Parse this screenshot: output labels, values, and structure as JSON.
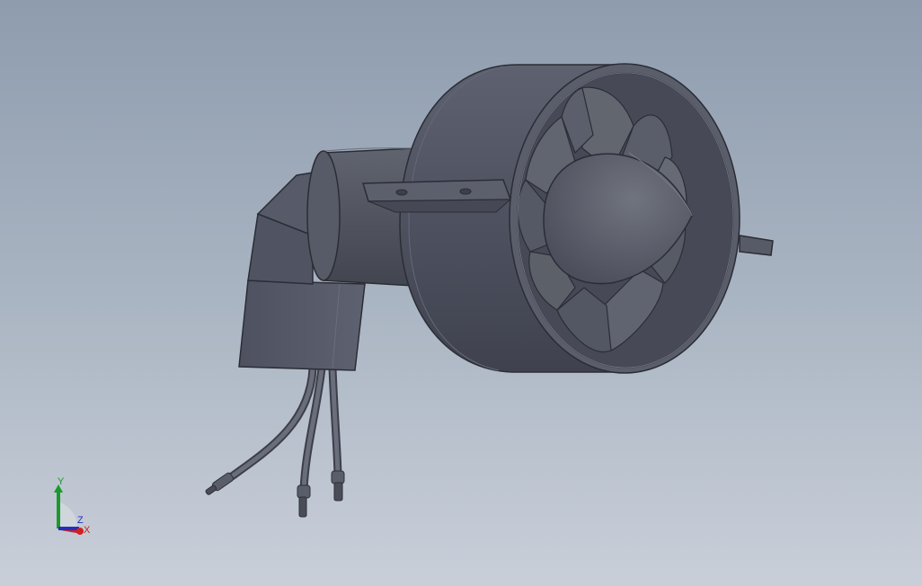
{
  "viewport": {
    "background_top": "#8e9cae",
    "background_bottom": "#c9cfd9",
    "model_color": "#545866"
  },
  "triad": {
    "x_label": "X",
    "y_label": "Y",
    "z_label": "Z",
    "x_color": "#d02020",
    "y_color": "#1a9a2a",
    "z_color": "#2030c0"
  }
}
